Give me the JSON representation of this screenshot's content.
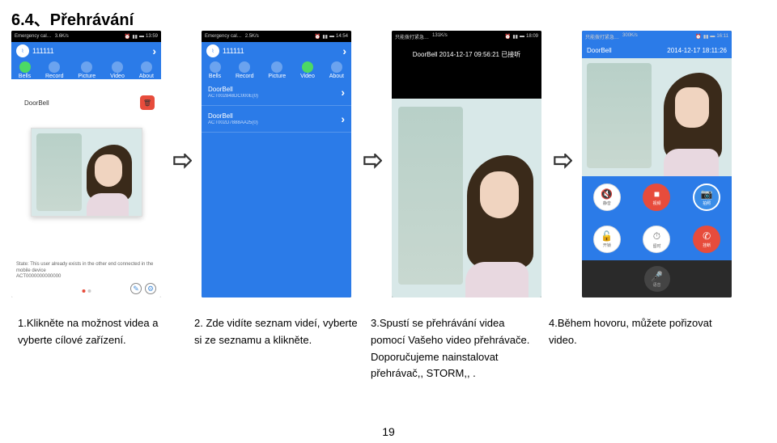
{
  "title": "6.4、Přehrávání",
  "page_num": "19",
  "screen1": {
    "status_left": "Emergency cal…",
    "status_speed": "3.6K/s",
    "status_time": "13:59",
    "header_num": "111111",
    "tabs": [
      "Bells",
      "Record",
      "Picture",
      "Video",
      "About"
    ],
    "doorbell": "DoorBell",
    "note": "State: This user already exists in the other end connected in the mobile device",
    "device_id": "ACT0000000000000"
  },
  "screen2": {
    "status_left": "Emergency cal…",
    "status_speed": "2.5K/s",
    "status_time": "14:54",
    "header_num": "111111",
    "tabs": [
      "Bells",
      "Record",
      "Picture",
      "Video",
      "About"
    ],
    "items": [
      {
        "name": "DoorBell",
        "sub": "ACT002848DC000E(0)"
      },
      {
        "name": "DoorBell",
        "sub": "ACT002D7888AA25(0)"
      }
    ]
  },
  "screen3": {
    "status_left": "只能拨打紧急…",
    "status_speed": "131K/s",
    "status_time": "18:09",
    "play_title": "DoorBell 2014-12-17 09:56:21 已接听"
  },
  "screen4": {
    "status_left": "只能拨打紧急…",
    "status_speed": "300K/s",
    "status_time": "16:11",
    "title": "DoorBell",
    "timestamp": "2014-12-17 18:11:26",
    "btns_r1": [
      "静音",
      "视频",
      "拍照"
    ],
    "btns_r2": [
      "开锁",
      "留时",
      "挂断"
    ],
    "mic": "语音"
  },
  "captions": {
    "c1": "1.Klikněte na možnost videa a vyberte cílové zařízení.",
    "c2": "2. Zde vidíte seznam videí, vyberte si ze seznamu a klikněte.",
    "c3": "3.Spustí se přehrávání videa pomocí Vašeho video přehrávače. Doporučujeme nainstalovat přehrávač,, STORM,, .",
    "c4": "4.Během hovoru, můžete pořizovat video."
  }
}
